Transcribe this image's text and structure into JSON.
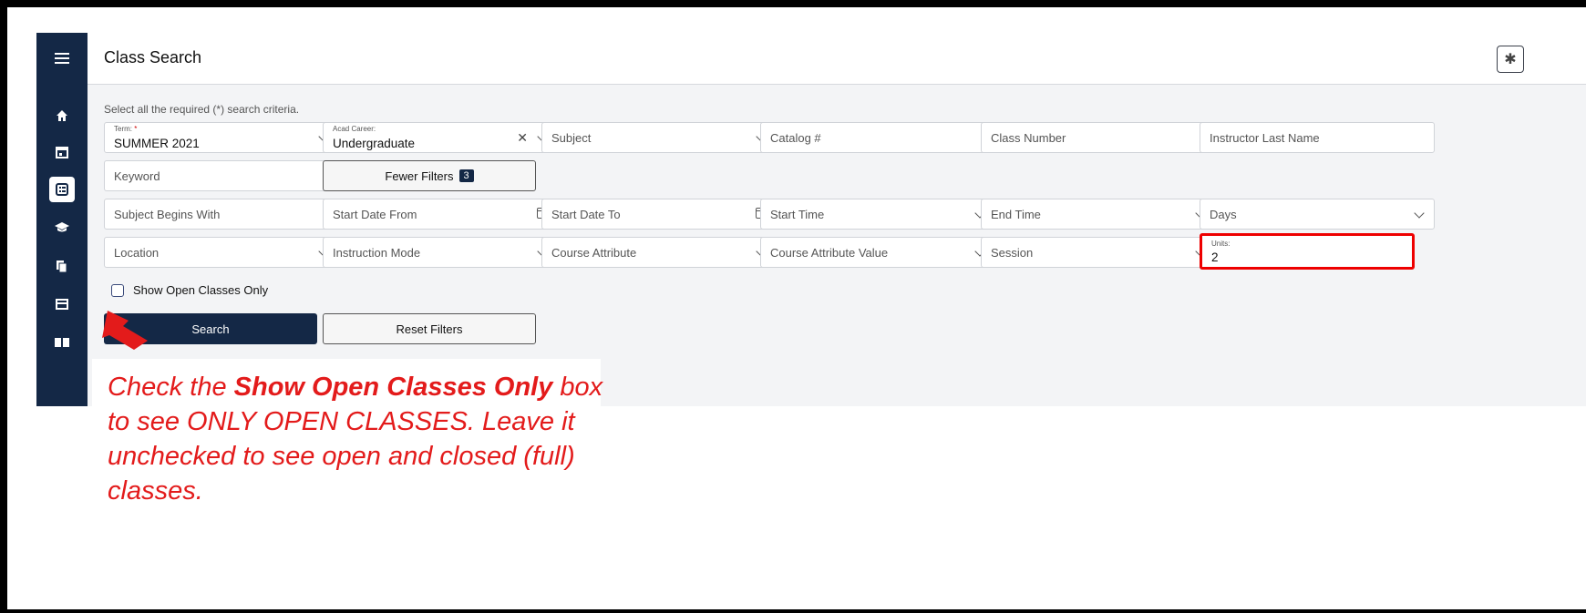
{
  "header": {
    "title": "Class Search"
  },
  "sidebar": {
    "items": [
      {
        "icon": "menu-icon",
        "glyph": "≡"
      },
      {
        "icon": "home-icon",
        "glyph": "⌂"
      },
      {
        "icon": "calendar-icon",
        "glyph": "▣"
      },
      {
        "icon": "class-search-icon",
        "glyph": "▤",
        "active": true
      },
      {
        "icon": "graduation-cap-icon",
        "glyph": "◆"
      },
      {
        "icon": "documents-icon",
        "glyph": "▧"
      },
      {
        "icon": "card-icon",
        "glyph": "▭"
      },
      {
        "icon": "book-icon",
        "glyph": "▩"
      }
    ]
  },
  "search": {
    "instructions": "Select all the required (*) search criteria.",
    "term": {
      "label": "Term:",
      "required": "*",
      "value": "SUMMER 2021"
    },
    "acad_career": {
      "label": "Acad Career:",
      "value": "Undergraduate"
    },
    "subject": "Subject",
    "catalog": "Catalog #",
    "class_number": "Class Number",
    "instructor_last_name": "Instructor Last Name",
    "keyword": "Keyword",
    "fewer_filters": {
      "label": "Fewer Filters",
      "count": "3"
    },
    "subject_begins_with": "Subject Begins With",
    "start_date_from": "Start Date From",
    "start_date_to": "Start Date To",
    "start_time": "Start Time",
    "end_time": "End Time",
    "days": "Days",
    "location": "Location",
    "instruction_mode": "Instruction Mode",
    "course_attribute": "Course Attribute",
    "course_attribute_value": "Course Attribute Value",
    "session": "Session",
    "units": {
      "label": "Units:",
      "value": "2"
    },
    "open_only": {
      "label": "Show Open Classes Only",
      "checked": false
    },
    "search_button": "Search",
    "reset_button": "Reset Filters"
  },
  "annotation": {
    "text_before": "Check the ",
    "text_bold": "Show Open Classes Only",
    "text_after": " box to see ONLY OPEN CLASSES. Leave it unchecked to see open and closed (full) classes.",
    "color": "#e31b1b"
  },
  "colors": {
    "navy": "#142846",
    "highlight": "#ee0000"
  }
}
